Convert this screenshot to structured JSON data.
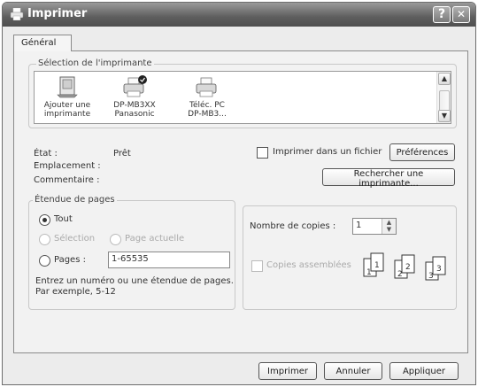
{
  "window": {
    "title": "Imprimer",
    "help_btn": "?",
    "close_btn": "✕"
  },
  "tab": {
    "label": "Général"
  },
  "printer_selection": {
    "title": "Sélection de l'imprimante",
    "printers": [
      {
        "line1": "Ajouter une",
        "line2": "imprimante",
        "icon": "add-printer-icon"
      },
      {
        "line1": "DP-MB3XX",
        "line2": "Panasonic",
        "icon": "printer-default-icon"
      },
      {
        "line1": "Téléc. PC",
        "line2": "DP-MB3...",
        "icon": "printer-icon"
      }
    ],
    "status_label": "État :",
    "status_value": "Prêt",
    "location_label": "Emplacement :",
    "comment_label": "Commentaire :",
    "print_to_file": "Imprimer dans un fichier",
    "preferences": "Préférences",
    "find_printer": "Rechercher une imprimante..."
  },
  "page_range": {
    "title": "Étendue de pages",
    "all": "Tout",
    "selection": "Sélection",
    "current_page": "Page actuelle",
    "pages": "Pages :",
    "pages_value": "1-65535",
    "hint_line1": "Entrez un numéro ou une étendue de pages.",
    "hint_line2": "Par exemple, 5-12"
  },
  "copies": {
    "label": "Nombre de copies :",
    "value": "1",
    "collate": "Copies assemblées"
  },
  "footer": {
    "print": "Imprimer",
    "cancel": "Annuler",
    "apply": "Appliquer"
  }
}
